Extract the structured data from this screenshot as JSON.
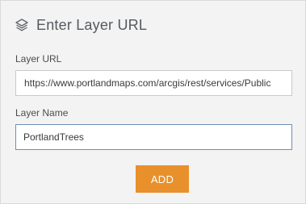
{
  "header": {
    "title": "Enter Layer URL",
    "icon": "layers-icon"
  },
  "form": {
    "url_label": "Layer URL",
    "url_value": "https://www.portlandmaps.com/arcgis/rest/services/Public",
    "name_label": "Layer Name",
    "name_value": "PortlandTrees",
    "add_label": "ADD"
  },
  "colors": {
    "accent": "#e8912c",
    "panel_bg": "#f3f3f3",
    "focus_border": "#6f8fb3"
  }
}
